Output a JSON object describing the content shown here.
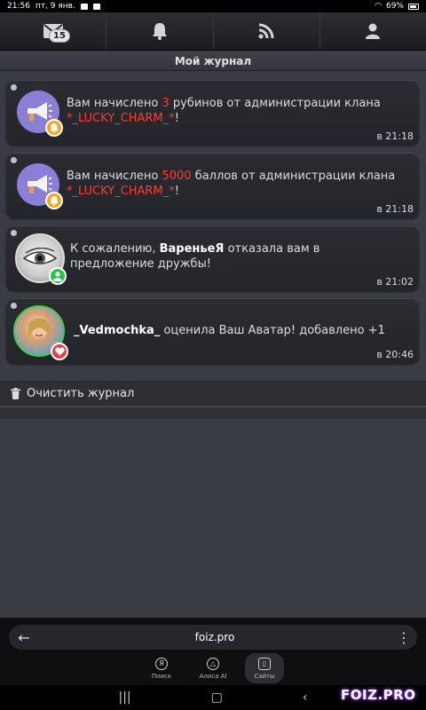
{
  "status": {
    "time": "21:56",
    "date": "пт, 9 янв.",
    "battery": "69%"
  },
  "nav": {
    "mail_badge": "15",
    "icons": [
      "mail-icon",
      "bell-icon",
      "rss-icon",
      "user-icon"
    ]
  },
  "page": {
    "title": "Мой журнал"
  },
  "entries": [
    {
      "prefix": "Вам начислено ",
      "amount": "3",
      "suffix": " рубинов от администрации клана ",
      "clan": "*_LUCKY_CHARM_*",
      "end": "!",
      "time": "в 21:18"
    },
    {
      "prefix": "Вам начислено ",
      "amount": "5000",
      "suffix": " баллов от администрации клана ",
      "clan": "*_LUCKY_CHARM_*",
      "end": "!",
      "time": "в 21:18"
    },
    {
      "prefix": "К сожалению, ",
      "user": "ВареньеЯ",
      "suffix": " отказала вам в предложение дружбы!",
      "time": "в 21:02"
    },
    {
      "user": "_Vedmochka_",
      "suffix": " оценила Ваш Аватар! добавлено +1",
      "time": "в 20:46"
    }
  ],
  "clear_label": "Очистить журнал",
  "browser": {
    "url": "foiz.pro",
    "tabs": [
      {
        "icon": "Я",
        "label": "Поиск"
      },
      {
        "icon": "△",
        "label": "Алиса AI"
      },
      {
        "icon": "▯",
        "label": "Сайты"
      }
    ]
  },
  "watermark": "FOIZ.PRO",
  "colors": {
    "accent_red": "#ff3b2e",
    "bg": "#3a3c44",
    "card": "#2a2c32"
  }
}
